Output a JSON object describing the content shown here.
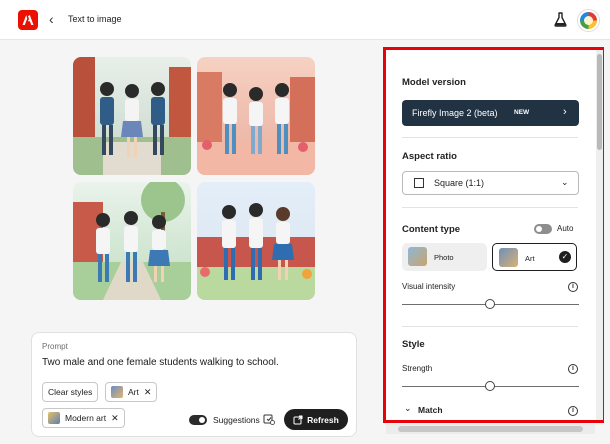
{
  "header": {
    "back_icon": "chevron-left-icon",
    "title": "Text to image",
    "labs_icon": "flask-icon",
    "brand_color": "#eb1000"
  },
  "gallery": {
    "images": [
      {
        "description": "Two boys and a girl with backpacks walking past red brick school buildings, illustration",
        "dominant_colors": [
          "#d8e4dc",
          "#b8503c",
          "#2f5d87"
        ]
      },
      {
        "description": "Three students walking on a pink path with flowers and brick walls, illustration",
        "dominant_colors": [
          "#f1c2b3",
          "#4e8fbf",
          "#e26d57"
        ]
      },
      {
        "description": "Three students walking in a green park near a red building, illustration",
        "dominant_colors": [
          "#d4e8d6",
          "#3d7ab5",
          "#d65a53"
        ]
      },
      {
        "description": "Three students holding hands walking in front of a school with flowers, illustration",
        "dominant_colors": [
          "#dfe9f3",
          "#2f6db0",
          "#e05656"
        ]
      }
    ]
  },
  "prompt": {
    "label": "Prompt",
    "text": "Two male and one female students walking to school.",
    "clear_styles_label": "Clear styles",
    "chips": [
      {
        "label": "Art",
        "remove_icon": "close-icon"
      },
      {
        "label": "Modern art",
        "remove_icon": "close-icon"
      }
    ],
    "suggestions_label": "Suggestions",
    "suggestions_on": true,
    "refresh_label": "Refresh"
  },
  "settings_panel": {
    "highlight_color": "#e8000b",
    "model_version": {
      "title": "Model version",
      "value": "Firefly Image 2 (beta)",
      "badge": "NEW"
    },
    "aspect_ratio": {
      "title": "Aspect ratio",
      "value": "Square (1:1)"
    },
    "content_type": {
      "title": "Content type",
      "auto_label": "Auto",
      "auto_on": false,
      "options": [
        {
          "label": "Photo",
          "selected": false
        },
        {
          "label": "Art",
          "selected": true
        }
      ],
      "visual_intensity_label": "Visual intensity",
      "visual_intensity_value": 0.5
    },
    "style": {
      "title": "Style",
      "strength_label": "Strength",
      "strength_value": 0.5,
      "match_label": "Match"
    }
  }
}
